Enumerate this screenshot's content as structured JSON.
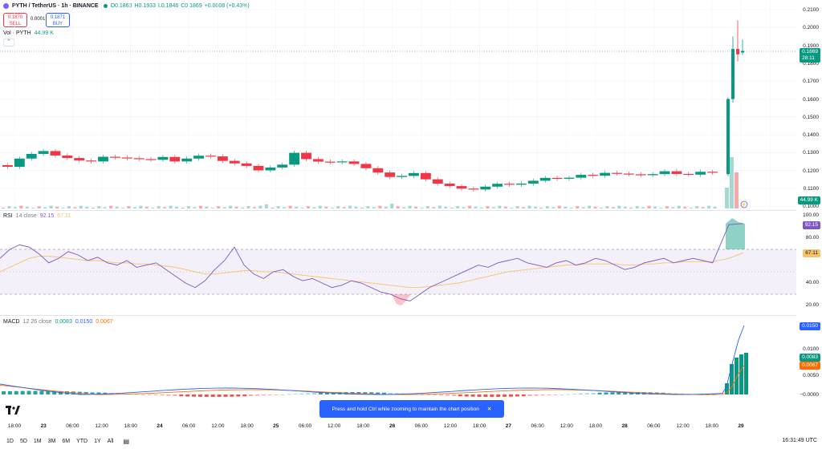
{
  "header": {
    "symbol": "PYTH / TetherUS · 1h · BINANCE",
    "ohlc": {
      "o": "O0.1863",
      "h": "H0.1933",
      "l": "L0.1846",
      "c": "C0.1869",
      "chg": "+0.0008 (+0.43%)"
    },
    "sell_price": "0.1870",
    "sell_label": "SELL",
    "spread": "0.0001",
    "buy_price": "0.1871",
    "buy_label": "BUY",
    "vol_label": "Vol · PYTH",
    "vol_value": "44.99 K"
  },
  "price_axis": {
    "labels": [
      "0.2100",
      "0.2000",
      "0.1900",
      "0.1800",
      "0.1700",
      "0.1600",
      "0.1500",
      "0.1400",
      "0.1300",
      "0.1200",
      "0.1100",
      "0.1000"
    ],
    "last_price": "0.1869",
    "countdown": "28:11",
    "vol_tag": "44.99 K"
  },
  "rsi": {
    "label": "RSI",
    "params": "14 close",
    "value": "92.15",
    "ma_value": "67.11",
    "axis_labels": [
      "100.00",
      "80.00",
      "60.00",
      "40.00",
      "20.00"
    ]
  },
  "macd": {
    "label": "MACD",
    "params": "12 26 close",
    "hist": "0.0083",
    "macd": "0.0150",
    "signal": "0.0067",
    "axis_labels": [
      "0.0100",
      "0.0050",
      "−0.0000"
    ],
    "tag_macd": "0.0150",
    "tag_hist": "0.0083",
    "tag_signal": "0.0067"
  },
  "time_axis": [
    "18:00",
    "23",
    "06:00",
    "12:00",
    "18:00",
    "24",
    "06:00",
    "12:00",
    "18:00",
    "25",
    "06:00",
    "12:00",
    "18:00",
    "26",
    "06:00",
    "12:00",
    "18:00",
    "27",
    "06:00",
    "12:00",
    "18:00",
    "28",
    "06:00",
    "12:00",
    "18:00",
    "29"
  ],
  "bottom_bar": {
    "ranges": [
      "1D",
      "5D",
      "1M",
      "3M",
      "6M",
      "YTD",
      "1Y",
      "All"
    ],
    "clock": "16:31:49 UTC"
  },
  "toast": {
    "text": "Press and hold Ctrl while zooming to maintain the chart position",
    "close": "✕"
  },
  "colors": {
    "up": "#089981",
    "down": "#f23645",
    "rsi_line": "#7e57c2",
    "rsi_ma": "#f7c36b",
    "macd": "#2962ff",
    "signal": "#ff6d00",
    "accent": "#2962ff"
  }
}
